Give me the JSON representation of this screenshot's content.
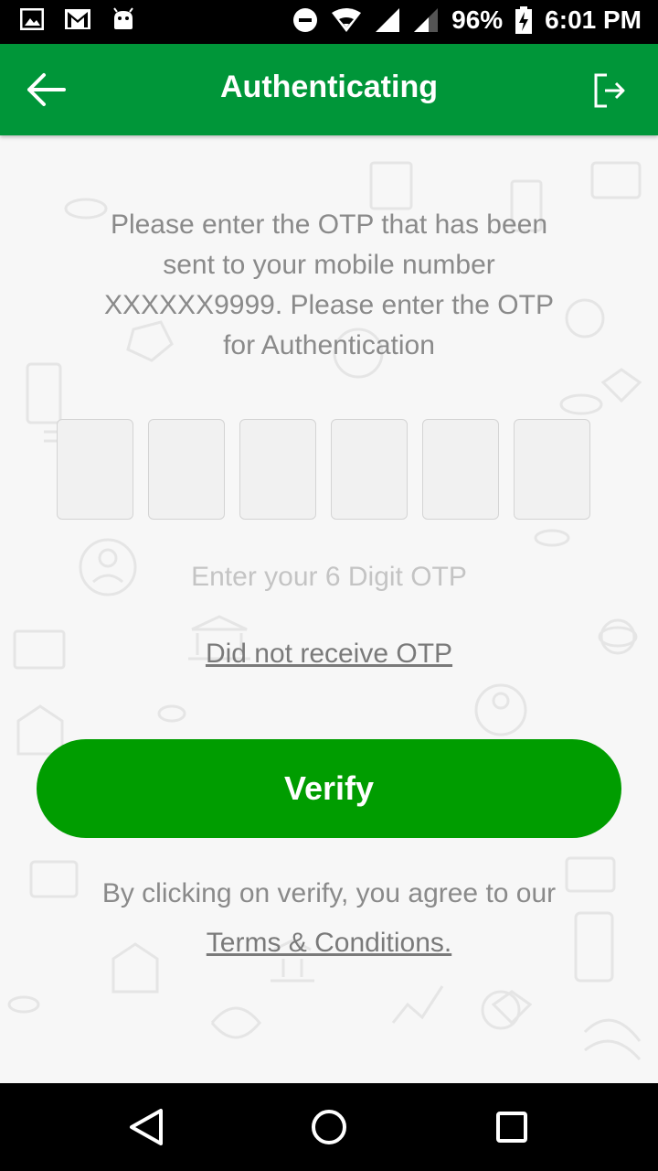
{
  "status_bar": {
    "battery": "96%",
    "time": "6:01 PM",
    "icons": [
      "image-icon",
      "gmail-icon",
      "android-icon",
      "do-not-disturb-icon",
      "wifi-icon",
      "signal-icon",
      "signal-icon",
      "battery-charging-icon"
    ]
  },
  "app_bar": {
    "title": "Authenticating",
    "back_icon": "arrow-left-icon",
    "logout_icon": "logout-icon"
  },
  "otp": {
    "instruction": "Please enter the OTP that has been sent to your mobile number XXXXXX9999. Please enter the OTP for Authentication",
    "digits": [
      "",
      "",
      "",
      "",
      "",
      ""
    ],
    "hint": "Enter your 6 Digit OTP",
    "resend_label": "Did not receive OTP"
  },
  "verify_label": "Verify",
  "agreement": {
    "text": "By clicking on verify, you agree to our",
    "terms_link": "Terms & Conditions."
  },
  "colors": {
    "primary": "#009639",
    "button": "#009d00",
    "background": "#f7f7f7",
    "text_muted": "#8a8a8a"
  },
  "nav_bar": {
    "icons": [
      "back-triangle-icon",
      "home-circle-icon",
      "recents-square-icon"
    ]
  }
}
